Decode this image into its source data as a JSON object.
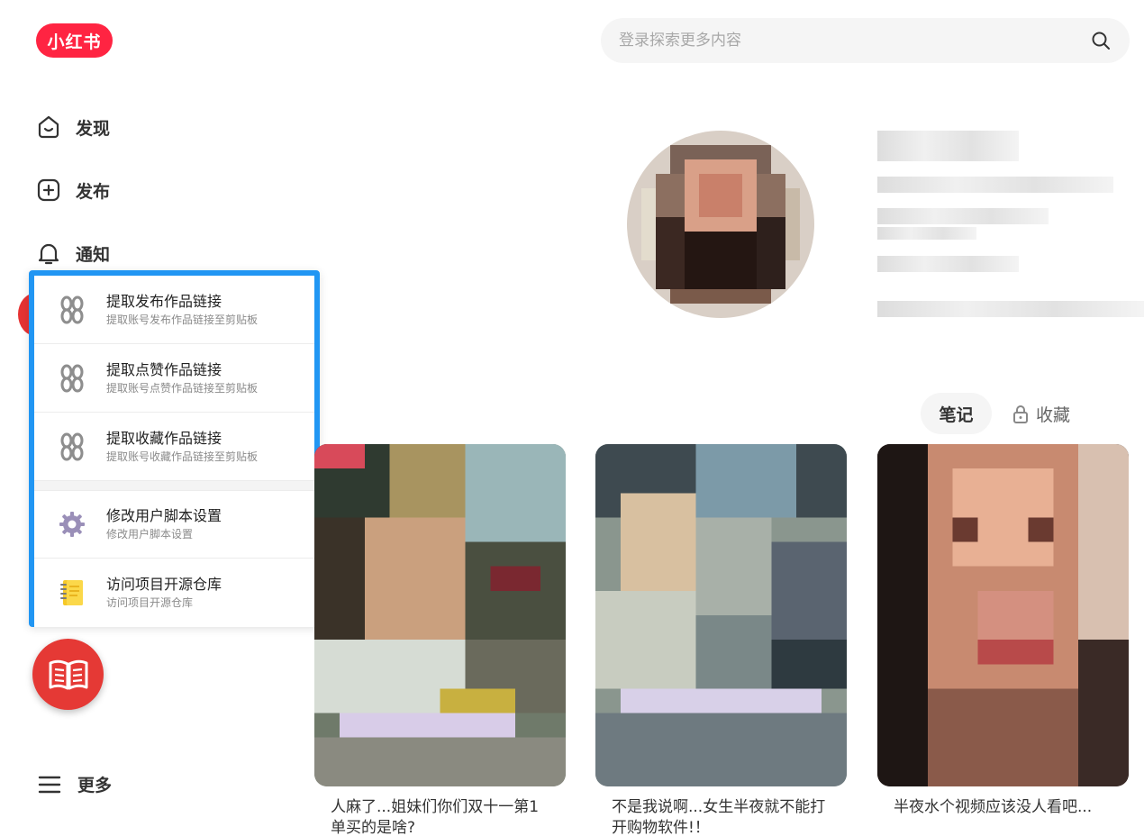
{
  "logo": {
    "text": "小红书"
  },
  "search": {
    "placeholder": "登录探索更多内容"
  },
  "nav": {
    "discover": "发现",
    "publish": "发布",
    "notify": "通知",
    "more": "更多"
  },
  "menu": {
    "items": [
      {
        "title": "提取发布作品链接",
        "sub": "提取账号发布作品链接至剪贴板",
        "icon": "chain-link-icon"
      },
      {
        "title": "提取点赞作品链接",
        "sub": "提取账号点赞作品链接至剪贴板",
        "icon": "chain-link-icon"
      },
      {
        "title": "提取收藏作品链接",
        "sub": "提取账号收藏作品链接至剪贴板",
        "icon": "chain-link-icon"
      },
      {
        "title": "修改用户脚本设置",
        "sub": "修改用户脚本设置",
        "icon": "gear-icon"
      },
      {
        "title": "访问项目开源仓库",
        "sub": "访问项目开源仓库",
        "icon": "notebook-icon"
      }
    ]
  },
  "tabs": {
    "notes": "笔记",
    "favorites": "收藏"
  },
  "cards": [
    {
      "title": "人麻了...姐妹们你们双十一第1单买的是啥?"
    },
    {
      "title": "不是我说啊...女生半夜就不能打开购物软件!！"
    },
    {
      "title": "半夜水个视频应该没人看吧..."
    }
  ],
  "colors": {
    "brand": "#ff2442",
    "menu_border": "#2196f3",
    "fab": "#e53935"
  }
}
